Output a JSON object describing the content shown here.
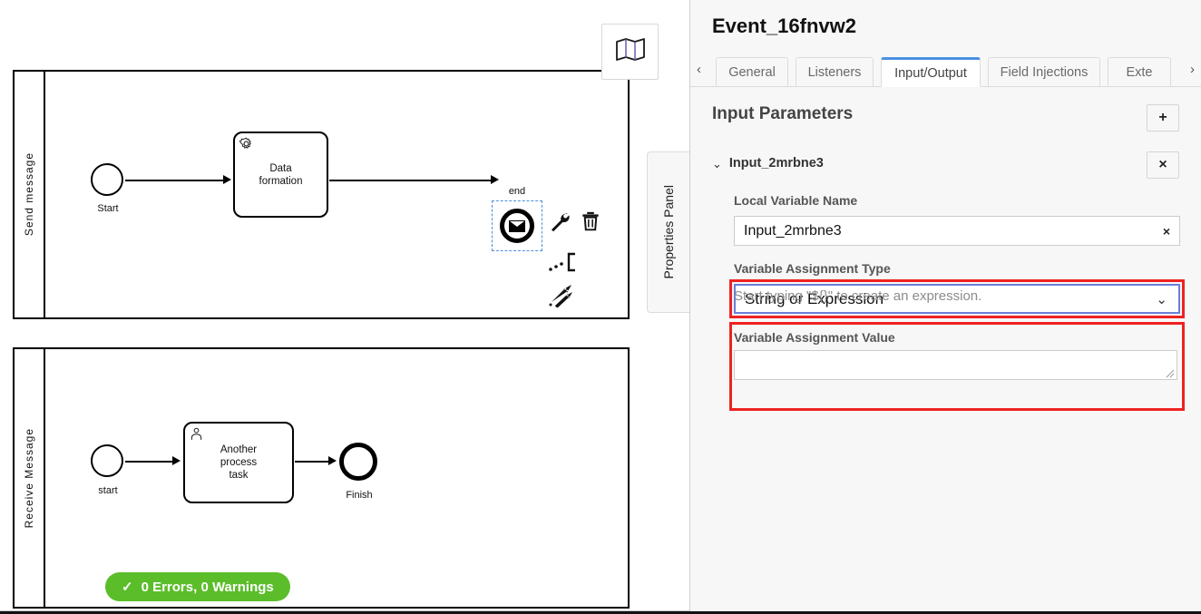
{
  "canvas": {
    "minimap_toggle_icon": "map-icon",
    "pools": [
      {
        "lane_label": "Send message",
        "nodes": {
          "start_label": "Start",
          "task_label": "Data\nformation",
          "task_icon": "gear-icon",
          "end_label": "end",
          "end_icon": "envelope-icon"
        }
      },
      {
        "lane_label": "Receive Message",
        "nodes": {
          "start_label": "start",
          "task_label": "Another\nprocess\ntask",
          "task_icon": "user-icon",
          "end_label": "Finish"
        }
      }
    ],
    "context_pad": [
      {
        "name": "wrench-icon",
        "title": "Change type"
      },
      {
        "name": "trash-icon",
        "title": "Delete"
      },
      {
        "name": "append-icon",
        "title": "Append"
      },
      {
        "name": "connect-icon",
        "title": "Connect"
      }
    ],
    "error_badge": {
      "icon": "check-icon",
      "text": "0 Errors, 0 Warnings",
      "color": "#5bbd2a"
    }
  },
  "properties_panel_tab": {
    "label": "Properties Panel"
  },
  "panel": {
    "element_title": "Event_16fnvw2",
    "tab_scroll_left": "‹",
    "tab_scroll_right": "›",
    "tabs": [
      {
        "label": "General",
        "active": false
      },
      {
        "label": "Listeners",
        "active": false
      },
      {
        "label": "Input/Output",
        "active": true
      },
      {
        "label": "Field Injections",
        "active": false
      },
      {
        "label": "Exte",
        "active": false
      }
    ],
    "section": {
      "title": "Input Parameters",
      "add_button": "+",
      "remove_button": "×"
    },
    "parameter": {
      "chevron": "⌄",
      "name": "Input_2mrbne3"
    },
    "fields": {
      "local_variable_name": {
        "label": "Local Variable Name",
        "value": "Input_2mrbne3",
        "clear": "×"
      },
      "variable_assignment_type": {
        "label": "Variable Assignment Type",
        "value": "String or Expression",
        "caret": "⌄",
        "highlight_color": "#ee2222",
        "focus_color": "#6b7fd7"
      },
      "variable_assignment_value": {
        "label": "Variable Assignment Value",
        "value": "",
        "hint": "Start typing \"${}\" to create an expression.",
        "highlight_color": "#ee2222"
      }
    }
  }
}
